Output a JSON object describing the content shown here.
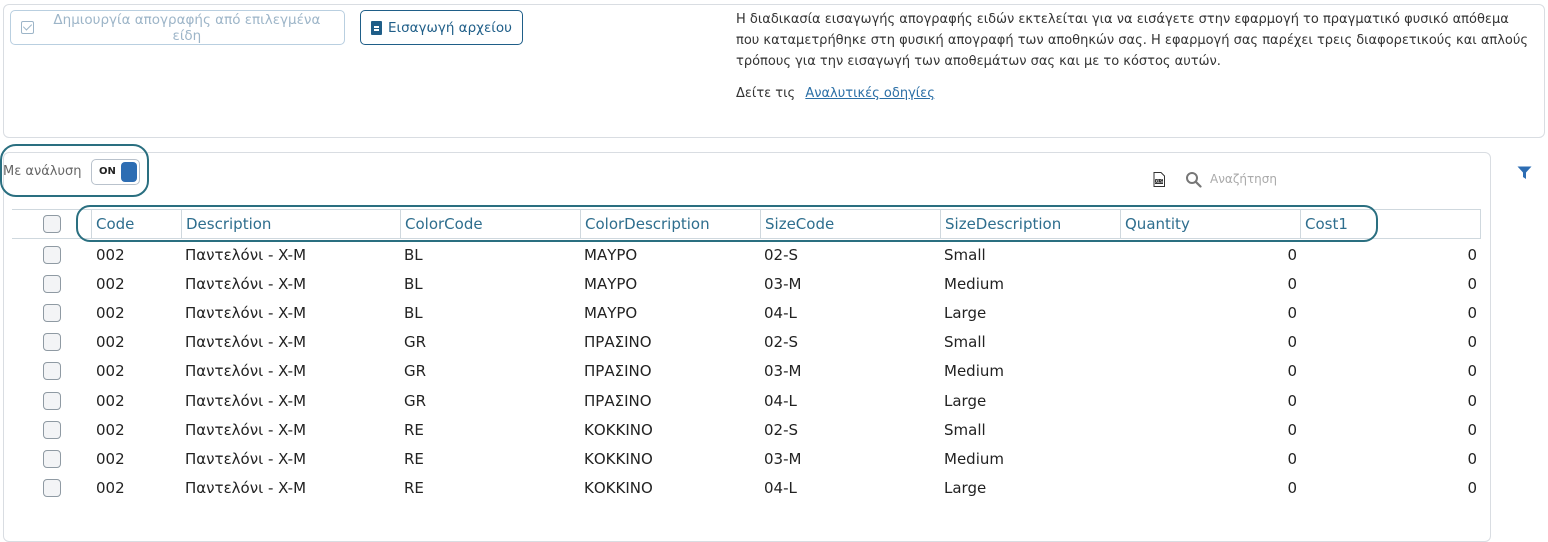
{
  "toolbar": {
    "create_label": "Δημιουργία απογραφής από επιλεγμένα είδη",
    "import_label": "Εισαγωγή αρχείου"
  },
  "info": {
    "text": "Η διαδικασία εισαγωγής απογραφής ειδών εκτελείται για να εισάγετε στην εφαρμογή το πραγματικό φυσικό απόθεμα που καταμετρήθηκε στη φυσική απογραφή των αποθηκών σας. Η εφαρμογή σας παρέχει τρεις διαφορετικούς και απλούς τρόπους για την εισαγωγή των αποθεμάτων σας και με το κόστος αυτών.",
    "link_prefix": "Δείτε τις",
    "link_text": "Αναλυτικές οδηγίες"
  },
  "toggle": {
    "label": "Με ανάλυση",
    "state": "ON"
  },
  "search": {
    "placeholder": "Αναζήτηση"
  },
  "table": {
    "columns": [
      "Code",
      "Description",
      "ColorCode",
      "ColorDescription",
      "SizeCode",
      "SizeDescription",
      "Quantity",
      "Cost1"
    ],
    "rows": [
      [
        "002",
        "Παντελόνι - X-M",
        "BL",
        "ΜΑΥΡΟ",
        "02-S",
        "Small",
        "0",
        "0"
      ],
      [
        "002",
        "Παντελόνι - X-M",
        "BL",
        "ΜΑΥΡΟ",
        "03-M",
        "Medium",
        "0",
        "0"
      ],
      [
        "002",
        "Παντελόνι - X-M",
        "BL",
        "ΜΑΥΡΟ",
        "04-L",
        "Large",
        "0",
        "0"
      ],
      [
        "002",
        "Παντελόνι - X-M",
        "GR",
        "ΠΡΑΣΙΝΟ",
        "02-S",
        "Small",
        "0",
        "0"
      ],
      [
        "002",
        "Παντελόνι - X-M",
        "GR",
        "ΠΡΑΣΙΝΟ",
        "03-M",
        "Medium",
        "0",
        "0"
      ],
      [
        "002",
        "Παντελόνι - X-M",
        "GR",
        "ΠΡΑΣΙΝΟ",
        "04-L",
        "Large",
        "0",
        "0"
      ],
      [
        "002",
        "Παντελόνι - X-M",
        "RE",
        "ΚΟΚΚΙΝΟ",
        "02-S",
        "Small",
        "0",
        "0"
      ],
      [
        "002",
        "Παντελόνι - X-M",
        "RE",
        "ΚΟΚΚΙΝΟ",
        "03-M",
        "Medium",
        "0",
        "0"
      ],
      [
        "002",
        "Παντελόνι - X-M",
        "RE",
        "ΚΟΚΚΙΝΟ",
        "04-L",
        "Large",
        "0",
        "0"
      ]
    ]
  },
  "colors": {
    "accent": "#1f5e88",
    "highlight": "#2a6f80",
    "toggle_on": "#2d6db3",
    "header_text": "#2e6e8e"
  },
  "icons": {
    "create": "check-square-icon",
    "import": "file-import-icon",
    "export": "excel-icon",
    "search": "search-icon",
    "filter": "filter-icon"
  }
}
